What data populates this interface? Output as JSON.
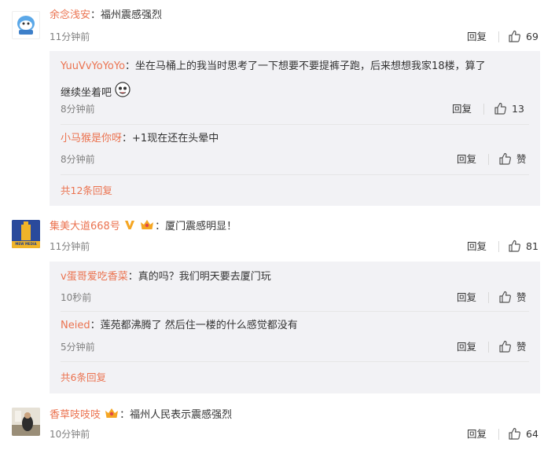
{
  "comments": [
    {
      "user": "余念浅安",
      "text": "福州震感强烈",
      "time": "11分钟前",
      "reply_label": "回复",
      "likes": "69",
      "replies": [
        {
          "user": "YuuVvYoYoYo",
          "text_line1": "坐在马桶上的我当时思考了一下想要不要提裤子跑，后来想想我家18楼，算了",
          "text_line2": "继续坐着吧",
          "time": "8分钟前",
          "reply_label": "回复",
          "likes": "13"
        },
        {
          "user": "小马猴是你呀",
          "text": "+1现在还在头晕中",
          "time": "8分钟前",
          "reply_label": "回复",
          "likes": "赞"
        }
      ],
      "more_label": "共12条回复"
    },
    {
      "user": "集美大道668号",
      "text": "厦门震感明显！",
      "time": "11分钟前",
      "reply_label": "回复",
      "likes": "81",
      "avatar_text": "MEW MEDIA",
      "replies": [
        {
          "user": "v蛋哥爱吃香菜",
          "text": "真的吗？我们明天要去厦门玩",
          "time": "10秒前",
          "reply_label": "回复",
          "likes": "赞"
        },
        {
          "user": "Neied",
          "text": "莲苑都沸腾了 然后住一楼的什么感觉都没有",
          "time": "5分钟前",
          "reply_label": "回复",
          "likes": "赞"
        }
      ],
      "more_label": "共6条回复"
    },
    {
      "user": "香草吱吱吱",
      "text": "福州人民表示震感强烈",
      "time": "10分钟前",
      "reply_label": "回复",
      "likes": "64"
    }
  ],
  "colors": {
    "name": "#eb7350",
    "reply_bg": "#f2f2f5",
    "vip": "#f5a623"
  },
  "separator": "："
}
